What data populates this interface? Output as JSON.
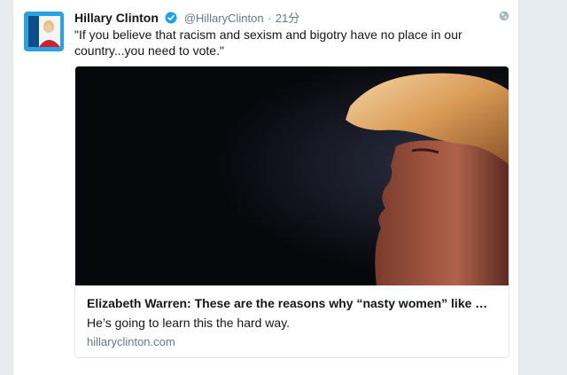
{
  "tweet": {
    "author_name": "Hillary Clinton",
    "handle": "@HillaryClinton",
    "separator": "·",
    "time": "21分",
    "text": "\"If you believe that racism and sexism and bigotry have no place in our country...you need to vote.\"",
    "icons": {
      "avatar": "avatar-logo",
      "verified": "verified-badge-icon",
      "globe": "globe-icon"
    }
  },
  "card": {
    "title": "Elizabeth Warren: These are the reasons why “nasty women” like m...",
    "description": "He’s going to learn this the hard way.",
    "domain": "hillaryclinton.com",
    "image": "portrait-photo"
  },
  "colors": {
    "page_background": "#e6ecf0",
    "verified_blue": "#1da1f2",
    "avatar_brand": "#2aa1e0",
    "avatar_red": "#cc1f2f"
  }
}
